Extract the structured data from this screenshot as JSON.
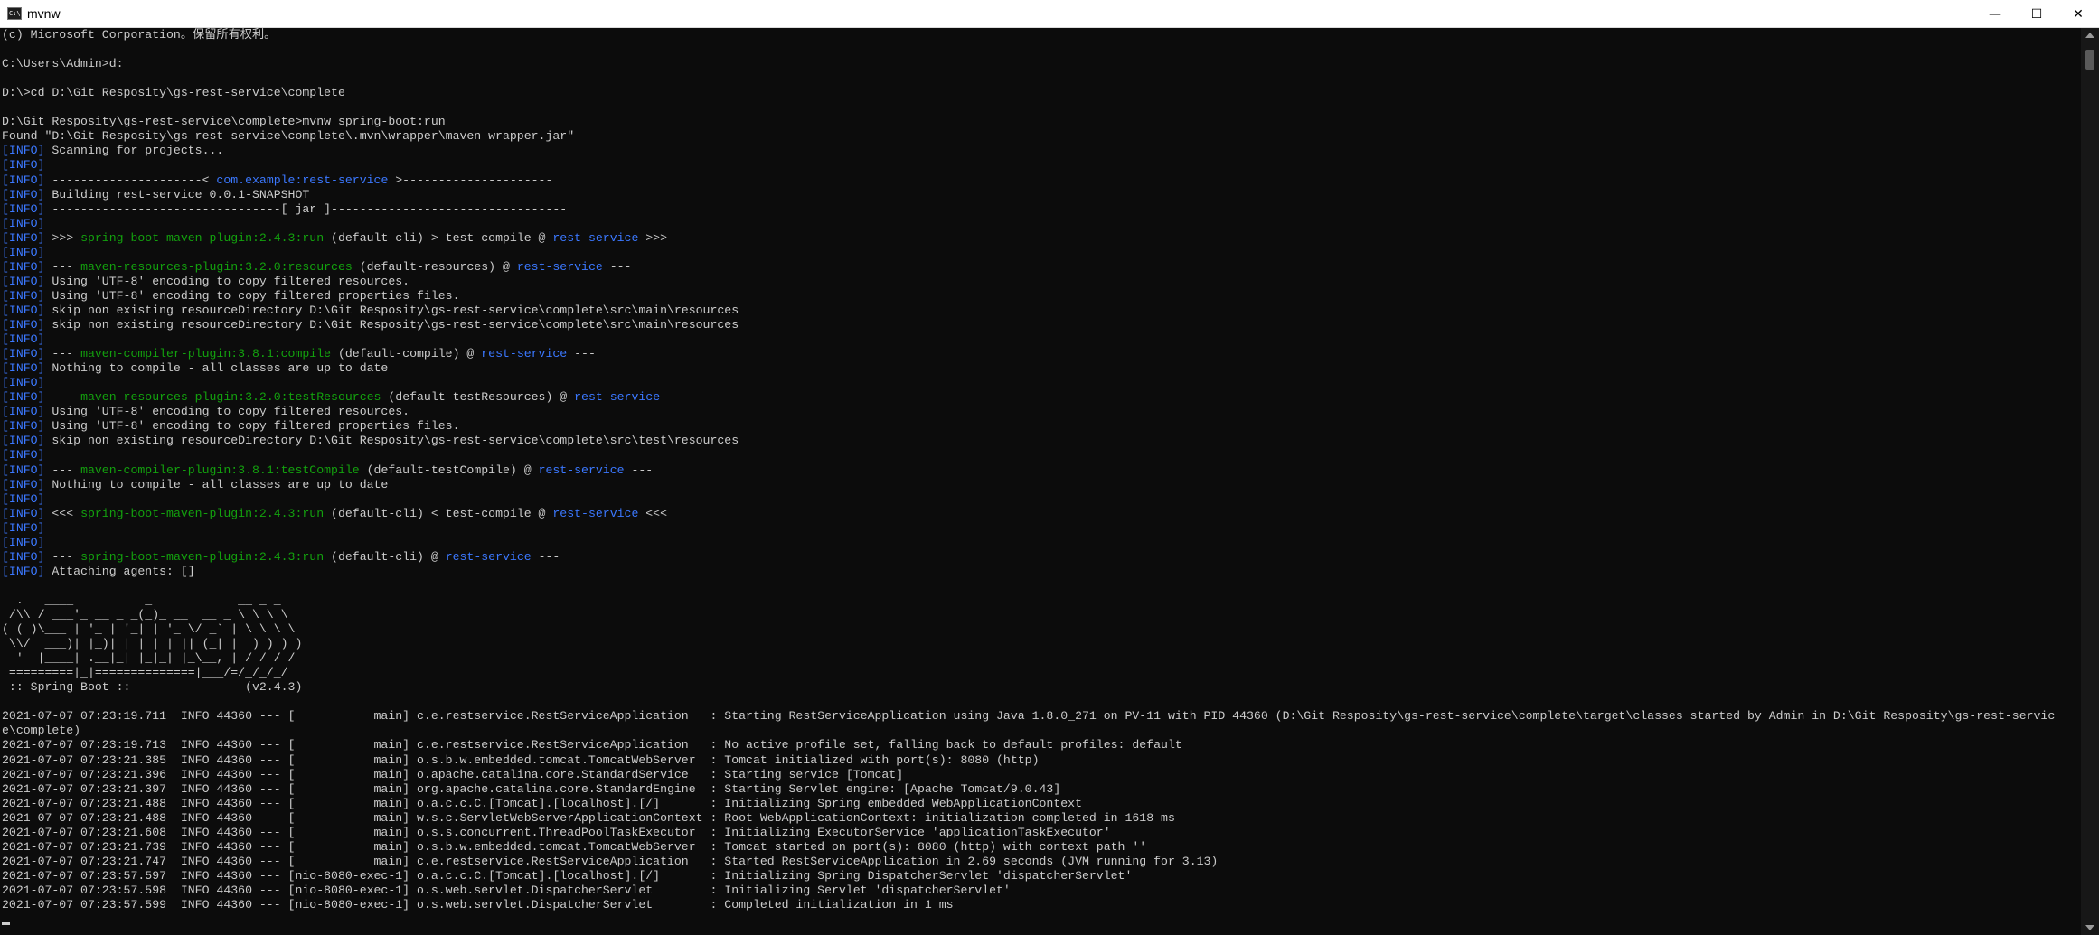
{
  "window": {
    "title": "mvnw",
    "minimize_glyph": "—",
    "maximize_glyph": "☐",
    "close_glyph": "✕"
  },
  "colors": {
    "info_tag": "#3b78ff",
    "plugin": "#13a10e",
    "project": "#3b78ff",
    "text": "#cccccc",
    "background": "#0c0c0c"
  },
  "console": {
    "lines": [
      [
        [
          "(c) Microsoft Corporation。保留所有权利。",
          "t"
        ]
      ],
      [
        [
          "",
          "t"
        ]
      ],
      [
        [
          "C:\\Users\\Admin>d:",
          "t"
        ]
      ],
      [
        [
          "",
          "t"
        ]
      ],
      [
        [
          "D:\\>cd D:\\Git Resposity\\gs-rest-service\\complete",
          "t"
        ]
      ],
      [
        [
          "",
          "t"
        ]
      ],
      [
        [
          "D:\\Git Resposity\\gs-rest-service\\complete>mvnw spring-boot:run",
          "t"
        ]
      ],
      [
        [
          "Found \"D:\\Git Resposity\\gs-rest-service\\complete\\.mvn\\wrapper\\maven-wrapper.jar\"",
          "t"
        ]
      ],
      [
        [
          "[INFO]",
          "i"
        ],
        [
          " Scanning for projects...",
          "t"
        ]
      ],
      [
        [
          "[INFO]",
          "i"
        ]
      ],
      [
        [
          "[INFO]",
          "i"
        ],
        [
          " ---------------------< ",
          "t"
        ],
        [
          "com.example:rest-service",
          "p"
        ],
        [
          " >---------------------",
          "t"
        ]
      ],
      [
        [
          "[INFO]",
          "i"
        ],
        [
          " Building rest-service 0.0.1-SNAPSHOT",
          "t"
        ]
      ],
      [
        [
          "[INFO]",
          "i"
        ],
        [
          " --------------------------------[ jar ]---------------------------------",
          "t"
        ]
      ],
      [
        [
          "[INFO]",
          "i"
        ]
      ],
      [
        [
          "[INFO]",
          "i"
        ],
        [
          " >>> ",
          "t"
        ],
        [
          "spring-boot-maven-plugin:2.4.3:run",
          "g"
        ],
        [
          " (default-cli) > test-compile @ ",
          "t"
        ],
        [
          "rest-service",
          "p"
        ],
        [
          " >>>",
          "t"
        ]
      ],
      [
        [
          "[INFO]",
          "i"
        ]
      ],
      [
        [
          "[INFO]",
          "i"
        ],
        [
          " --- ",
          "t"
        ],
        [
          "maven-resources-plugin:3.2.0:resources",
          "g"
        ],
        [
          " (default-resources) @ ",
          "t"
        ],
        [
          "rest-service",
          "p"
        ],
        [
          " ---",
          "t"
        ]
      ],
      [
        [
          "[INFO]",
          "i"
        ],
        [
          " Using 'UTF-8' encoding to copy filtered resources.",
          "t"
        ]
      ],
      [
        [
          "[INFO]",
          "i"
        ],
        [
          " Using 'UTF-8' encoding to copy filtered properties files.",
          "t"
        ]
      ],
      [
        [
          "[INFO]",
          "i"
        ],
        [
          " skip non existing resourceDirectory D:\\Git Resposity\\gs-rest-service\\complete\\src\\main\\resources",
          "t"
        ]
      ],
      [
        [
          "[INFO]",
          "i"
        ],
        [
          " skip non existing resourceDirectory D:\\Git Resposity\\gs-rest-service\\complete\\src\\main\\resources",
          "t"
        ]
      ],
      [
        [
          "[INFO]",
          "i"
        ]
      ],
      [
        [
          "[INFO]",
          "i"
        ],
        [
          " --- ",
          "t"
        ],
        [
          "maven-compiler-plugin:3.8.1:compile",
          "g"
        ],
        [
          " (default-compile) @ ",
          "t"
        ],
        [
          "rest-service",
          "p"
        ],
        [
          " ---",
          "t"
        ]
      ],
      [
        [
          "[INFO]",
          "i"
        ],
        [
          " Nothing to compile - all classes are up to date",
          "t"
        ]
      ],
      [
        [
          "[INFO]",
          "i"
        ]
      ],
      [
        [
          "[INFO]",
          "i"
        ],
        [
          " --- ",
          "t"
        ],
        [
          "maven-resources-plugin:3.2.0:testResources",
          "g"
        ],
        [
          " (default-testResources) @ ",
          "t"
        ],
        [
          "rest-service",
          "p"
        ],
        [
          " ---",
          "t"
        ]
      ],
      [
        [
          "[INFO]",
          "i"
        ],
        [
          " Using 'UTF-8' encoding to copy filtered resources.",
          "t"
        ]
      ],
      [
        [
          "[INFO]",
          "i"
        ],
        [
          " Using 'UTF-8' encoding to copy filtered properties files.",
          "t"
        ]
      ],
      [
        [
          "[INFO]",
          "i"
        ],
        [
          " skip non existing resourceDirectory D:\\Git Resposity\\gs-rest-service\\complete\\src\\test\\resources",
          "t"
        ]
      ],
      [
        [
          "[INFO]",
          "i"
        ]
      ],
      [
        [
          "[INFO]",
          "i"
        ],
        [
          " --- ",
          "t"
        ],
        [
          "maven-compiler-plugin:3.8.1:testCompile",
          "g"
        ],
        [
          " (default-testCompile) @ ",
          "t"
        ],
        [
          "rest-service",
          "p"
        ],
        [
          " ---",
          "t"
        ]
      ],
      [
        [
          "[INFO]",
          "i"
        ],
        [
          " Nothing to compile - all classes are up to date",
          "t"
        ]
      ],
      [
        [
          "[INFO]",
          "i"
        ]
      ],
      [
        [
          "[INFO]",
          "i"
        ],
        [
          " <<< ",
          "t"
        ],
        [
          "spring-boot-maven-plugin:2.4.3:run",
          "g"
        ],
        [
          " (default-cli) < test-compile @ ",
          "t"
        ],
        [
          "rest-service",
          "p"
        ],
        [
          " <<<",
          "t"
        ]
      ],
      [
        [
          "[INFO]",
          "i"
        ]
      ],
      [
        [
          "[INFO]",
          "i"
        ]
      ],
      [
        [
          "[INFO]",
          "i"
        ],
        [
          " --- ",
          "t"
        ],
        [
          "spring-boot-maven-plugin:2.4.3:run",
          "g"
        ],
        [
          " (default-cli) @ ",
          "t"
        ],
        [
          "rest-service",
          "p"
        ],
        [
          " ---",
          "t"
        ]
      ],
      [
        [
          "[INFO]",
          "i"
        ],
        [
          " Attaching agents: []",
          "t"
        ]
      ],
      [
        [
          "",
          "t"
        ]
      ],
      [
        [
          "  .   ____          _            __ _ _",
          "t"
        ]
      ],
      [
        [
          " /\\\\ / ___'_ __ _ _(_)_ __  __ _ \\ \\ \\ \\",
          "t"
        ]
      ],
      [
        [
          "( ( )\\___ | '_ | '_| | '_ \\/ _` | \\ \\ \\ \\",
          "t"
        ]
      ],
      [
        [
          " \\\\/  ___)| |_)| | | | | || (_| |  ) ) ) )",
          "t"
        ]
      ],
      [
        [
          "  '  |____| .__|_| |_|_| |_\\__, | / / / /",
          "t"
        ]
      ],
      [
        [
          " =========|_|==============|___/=/_/_/_/",
          "t"
        ]
      ],
      [
        [
          " :: Spring Boot ::                (v2.4.3)",
          "t"
        ]
      ],
      [
        [
          "",
          "t"
        ]
      ],
      [
        [
          "2021-07-07 07:23:19.711  INFO 44360 --- [           main] c.e.restservice.RestServiceApplication   : Starting RestServiceApplication using Java 1.8.0_271 on PV-11 with PID 44360 (D:\\Git Resposity\\gs-rest-service\\complete\\target\\classes started by Admin in D:\\Git Resposity\\gs-rest-servic",
          "t"
        ]
      ],
      [
        [
          "e\\complete)",
          "t"
        ]
      ],
      [
        [
          "2021-07-07 07:23:19.713  INFO 44360 --- [           main] c.e.restservice.RestServiceApplication   : No active profile set, falling back to default profiles: default",
          "t"
        ]
      ],
      [
        [
          "2021-07-07 07:23:21.385  INFO 44360 --- [           main] o.s.b.w.embedded.tomcat.TomcatWebServer  : Tomcat initialized with port(s): 8080 (http)",
          "t"
        ]
      ],
      [
        [
          "2021-07-07 07:23:21.396  INFO 44360 --- [           main] o.apache.catalina.core.StandardService   : Starting service [Tomcat]",
          "t"
        ]
      ],
      [
        [
          "2021-07-07 07:23:21.397  INFO 44360 --- [           main] org.apache.catalina.core.StandardEngine  : Starting Servlet engine: [Apache Tomcat/9.0.43]",
          "t"
        ]
      ],
      [
        [
          "2021-07-07 07:23:21.488  INFO 44360 --- [           main] o.a.c.c.C.[Tomcat].[localhost].[/]       : Initializing Spring embedded WebApplicationContext",
          "t"
        ]
      ],
      [
        [
          "2021-07-07 07:23:21.488  INFO 44360 --- [           main] w.s.c.ServletWebServerApplicationContext : Root WebApplicationContext: initialization completed in 1618 ms",
          "t"
        ]
      ],
      [
        [
          "2021-07-07 07:23:21.608  INFO 44360 --- [           main] o.s.s.concurrent.ThreadPoolTaskExecutor  : Initializing ExecutorService 'applicationTaskExecutor'",
          "t"
        ]
      ],
      [
        [
          "2021-07-07 07:23:21.739  INFO 44360 --- [           main] o.s.b.w.embedded.tomcat.TomcatWebServer  : Tomcat started on port(s): 8080 (http) with context path ''",
          "t"
        ]
      ],
      [
        [
          "2021-07-07 07:23:21.747  INFO 44360 --- [           main] c.e.restservice.RestServiceApplication   : Started RestServiceApplication in 2.69 seconds (JVM running for 3.13)",
          "t"
        ]
      ],
      [
        [
          "2021-07-07 07:23:57.597  INFO 44360 --- [nio-8080-exec-1] o.a.c.c.C.[Tomcat].[localhost].[/]       : Initializing Spring DispatcherServlet 'dispatcherServlet'",
          "t"
        ]
      ],
      [
        [
          "2021-07-07 07:23:57.598  INFO 44360 --- [nio-8080-exec-1] o.s.web.servlet.DispatcherServlet        : Initializing Servlet 'dispatcherServlet'",
          "t"
        ]
      ],
      [
        [
          "2021-07-07 07:23:57.599  INFO 44360 --- [nio-8080-exec-1] o.s.web.servlet.DispatcherServlet        : Completed initialization in 1 ms",
          "t"
        ]
      ]
    ]
  }
}
